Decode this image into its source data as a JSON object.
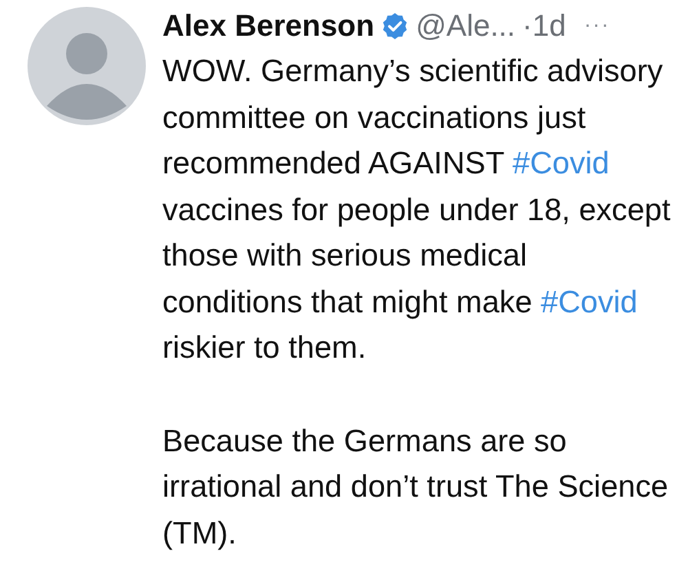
{
  "tweet": {
    "author": {
      "name": "Alex Berenson",
      "verified": true,
      "handle": "@Ale...",
      "time": "·1d",
      "more": "···"
    },
    "paragraphs": [
      [
        {
          "kind": "text",
          "text": "WOW. Germany’s scientific advisory committee on vaccinations just recommended AGAINST "
        },
        {
          "kind": "hashtag",
          "text": "#Covid"
        },
        {
          "kind": "text",
          "text": " vaccines for people under 18, except those with serious medical conditions that might make "
        },
        {
          "kind": "hashtag",
          "text": "#Covid"
        },
        {
          "kind": "text",
          "text": " riskier to them."
        }
      ],
      [
        {
          "kind": "text",
          "text": "Because the Germans are so irrational and don’t trust The Science (TM)."
        }
      ]
    ]
  }
}
